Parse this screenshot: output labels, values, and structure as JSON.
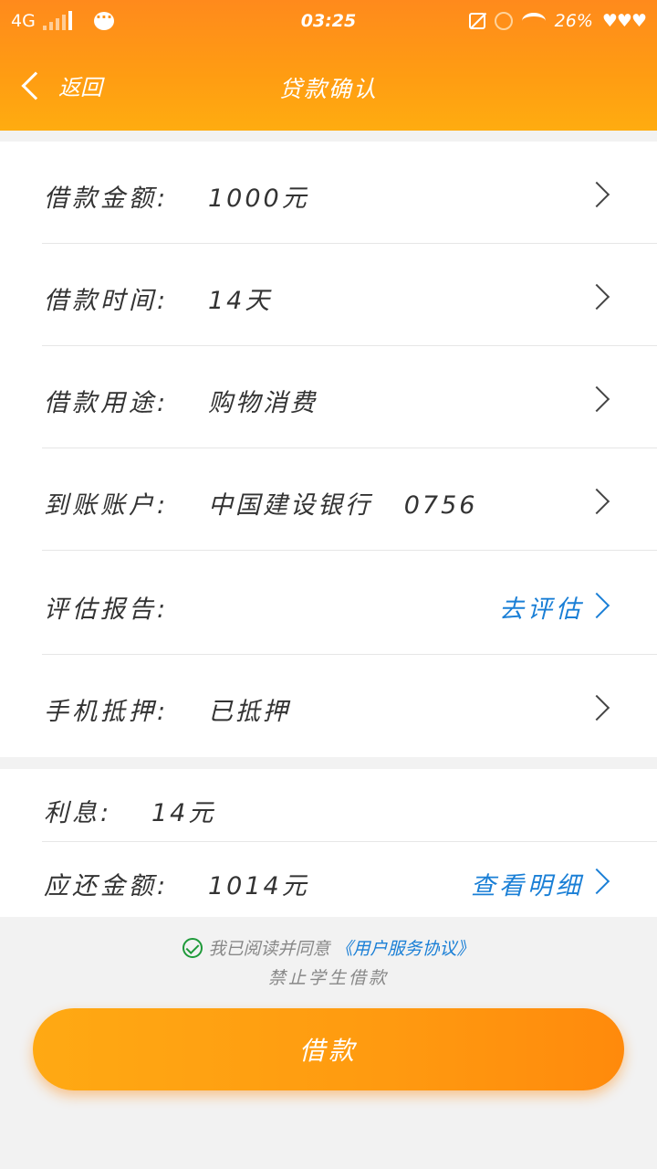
{
  "status_bar": {
    "network": "4G",
    "time": "03:25",
    "battery": "26%",
    "hearts": "♥♥♥"
  },
  "nav": {
    "back_label": "返回",
    "title": "贷款确认"
  },
  "loan_details": [
    {
      "label": "借款金额:",
      "value": "1000元"
    },
    {
      "label": "借款时间:",
      "value": "14天"
    },
    {
      "label": "借款用途:",
      "value": "购物消费"
    },
    {
      "label": "到账账户:",
      "value": "中国建设银行   0756"
    },
    {
      "label": "评估报告:",
      "value": "",
      "link": "去评估"
    },
    {
      "label": "手机抵押:",
      "value": "已抵押"
    }
  ],
  "summary": [
    {
      "label": "利息:",
      "value": "14元"
    },
    {
      "label": "应还金额:",
      "value": "1014元",
      "link": "查看明细"
    }
  ],
  "agreement": {
    "prefix": "我已阅读并同意",
    "protocol": "《用户服务协议》",
    "notice": "禁止学生借款"
  },
  "submit_label": "借款"
}
